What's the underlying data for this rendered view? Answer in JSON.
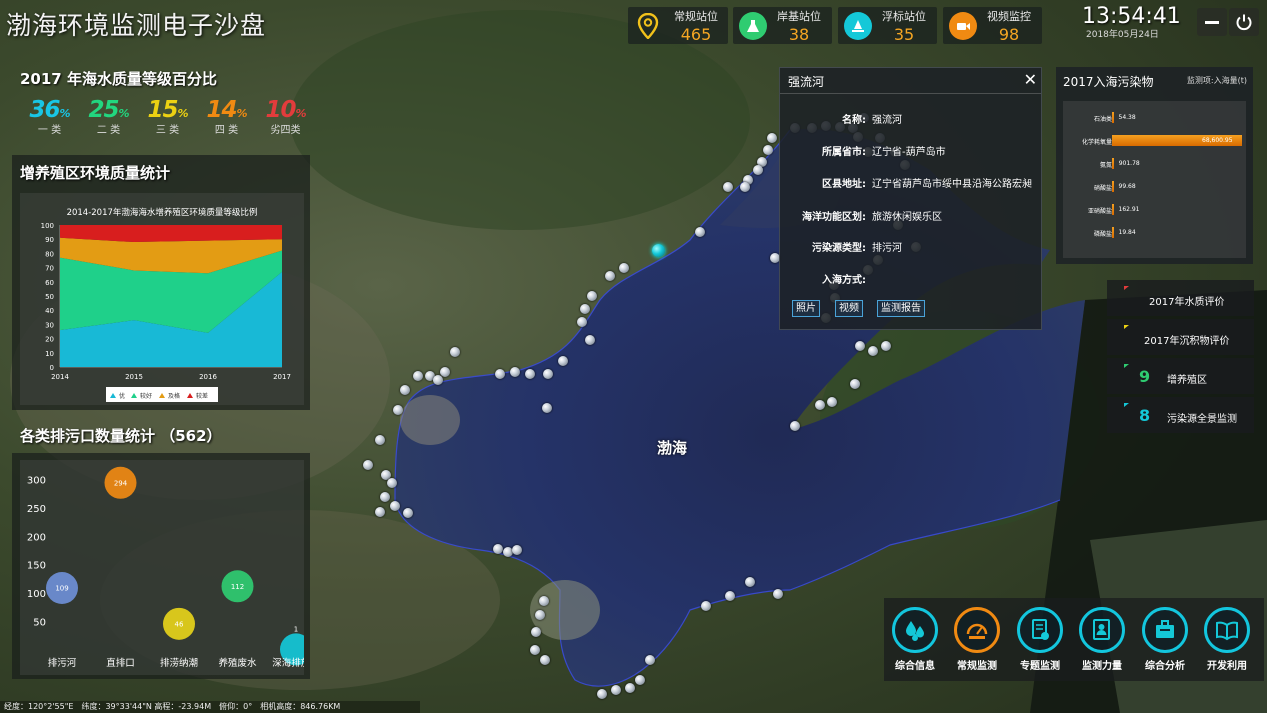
{
  "app": {
    "title": "渤海环境监测电子沙盘"
  },
  "stats": [
    {
      "label": "常规站位",
      "value": "465",
      "icon": "location-pin-icon",
      "color": "#f2c21b"
    },
    {
      "label": "岸基站位",
      "value": "38",
      "icon": "flask-icon",
      "color": "#2fcc71"
    },
    {
      "label": "浮标站位",
      "value": "35",
      "icon": "buoy-icon",
      "color": "#14c8d8"
    },
    {
      "label": "视频监控",
      "value": "98",
      "icon": "camera-icon",
      "color": "#f08a12"
    }
  ],
  "clock": {
    "time": "13:54:41",
    "date": "2018年05月24日"
  },
  "window": {
    "minimize_icon": "minimize-icon",
    "power_icon": "power-icon"
  },
  "sea_label": "渤海",
  "water_quality": {
    "title": "2017 年海水质量等级百分比",
    "items": [
      {
        "value": "36",
        "unit": "%",
        "label": "一 类",
        "color": "#19c6e6"
      },
      {
        "value": "25",
        "unit": "%",
        "label": "二 类",
        "color": "#22d67f"
      },
      {
        "value": "15",
        "unit": "%",
        "label": "三 类",
        "color": "#ecd113"
      },
      {
        "value": "14",
        "unit": "%",
        "label": "四 类",
        "color": "#f08a12"
      },
      {
        "value": "10",
        "unit": "%",
        "label": "劣四类",
        "color": "#e23c3c"
      }
    ]
  },
  "aquaculture": {
    "title": "增养殖区环境质量统计",
    "chart_title": "2014-2017年渤海海水增养殖区环境质量等级比例",
    "legend": [
      "优",
      "较好",
      "及格",
      "较差"
    ]
  },
  "outfalls": {
    "title": "各类排污口数量统计",
    "total": "（562）"
  },
  "chart_data": [
    {
      "type": "area",
      "title": "2014-2017年渤海海水增养殖区环境质量等级比例",
      "x": [
        2014,
        2015,
        2016,
        2017
      ],
      "ylim": [
        0,
        100
      ],
      "yticks": [
        0,
        10,
        20,
        30,
        40,
        50,
        60,
        70,
        80,
        90,
        100
      ],
      "stacked": true,
      "series": [
        {
          "name": "优",
          "values": [
            26,
            33,
            24,
            67
          ],
          "color": "#18b9d6"
        },
        {
          "name": "较好",
          "values": [
            51,
            35,
            42,
            15
          ],
          "color": "#1fd08a"
        },
        {
          "name": "及格",
          "values": [
            14,
            20,
            23,
            8
          ],
          "color": "#e39c14"
        },
        {
          "name": "较差",
          "values": [
            9,
            12,
            11,
            10
          ],
          "color": "#d81e1e"
        }
      ],
      "legend_placement": "bottom"
    },
    {
      "type": "scatter",
      "title": "各类排污口数量统计",
      "categories": [
        "排污河",
        "直排口",
        "排涝纳潮",
        "养殖废水",
        "深海排放口"
      ],
      "values": [
        109,
        294,
        46,
        112,
        1
      ],
      "ylim": [
        0,
        320
      ],
      "yticks": [
        50,
        100,
        150,
        200,
        250,
        300
      ],
      "colors": [
        "#6e8fd6",
        "#f08a12",
        "#e6d21a",
        "#2fcc71",
        "#14c8d8"
      ]
    },
    {
      "type": "bar",
      "title": "2017入海污染物",
      "categories": [
        "石油类",
        "化学耗氧量",
        "氨氮",
        "硝酸盐",
        "亚硝酸盐",
        "磷酸盐"
      ],
      "values": [
        54.38,
        68600.95,
        901.78,
        99.68,
        162.91,
        19.84
      ],
      "value_labels": [
        "54.38",
        "68,600.95",
        "901.78",
        "99.68",
        "162.91",
        "19.84"
      ]
    }
  ],
  "popup": {
    "title": "强流河",
    "close_icon": "close-icon",
    "fields": [
      {
        "key": "名称:",
        "value": "强流河"
      },
      {
        "key": "所属省市:",
        "value": "辽宁省-葫芦岛市"
      },
      {
        "key": "区县地址:",
        "value": "辽宁省葫芦岛市绥中县沿海公路宏昶"
      },
      {
        "key": "海洋功能区划:",
        "value": "旅游休闲娱乐区"
      },
      {
        "key": "污染源类型:",
        "value": "排污河"
      },
      {
        "key": "入海方式:",
        "value": ""
      }
    ],
    "buttons": [
      "照片",
      "视频",
      "监测报告"
    ]
  },
  "pollutants": {
    "title": "2017入海污染物",
    "subtitle": "监测项:入海量(t)"
  },
  "right_menu": [
    {
      "num": "",
      "label": "2017年水质评价",
      "flag_color": "#e23c3c"
    },
    {
      "num": "",
      "label": "2017年沉积物评价",
      "flag_color": "#ecd113"
    },
    {
      "num": "9",
      "label": "增养殖区",
      "flag_color": "#2fcc71",
      "num_color": "#2fcc71"
    },
    {
      "num": "8",
      "label": "污染源全景监测",
      "flag_color": "#14c8d8",
      "num_color": "#14c8d8"
    }
  ],
  "bottom_nav": [
    {
      "label": "综合信息",
      "icon": "water-drops-icon"
    },
    {
      "label": "常规监测",
      "icon": "gauge-icon"
    },
    {
      "label": "专题监测",
      "icon": "document-stats-icon"
    },
    {
      "label": "监测力量",
      "icon": "user-badge-icon"
    },
    {
      "label": "综合分析",
      "icon": "briefcase-icon"
    },
    {
      "label": "开发利用",
      "icon": "book-icon"
    }
  ],
  "status_bar": {
    "text": "经度：120°2'55\"E　纬度：39°33'44\"N 高程：-23.94M　俯仰：0°　相机高度：846.76KM"
  }
}
